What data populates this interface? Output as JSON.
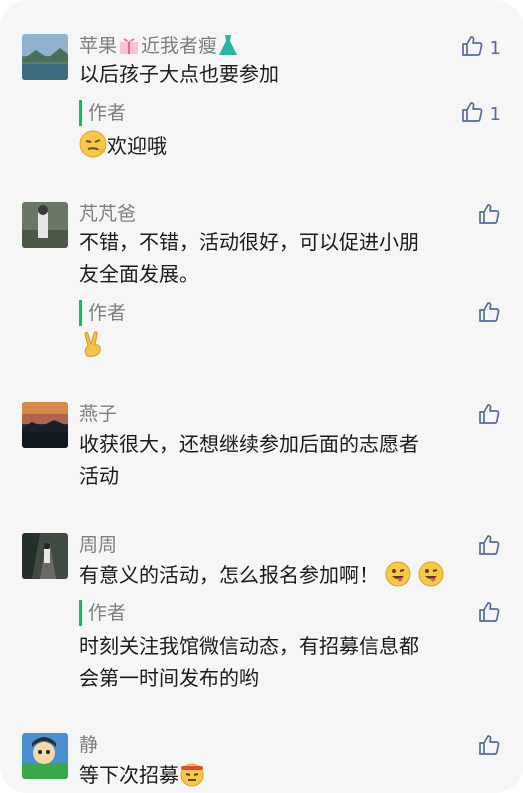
{
  "comments": [
    {
      "name": "苹果",
      "name_suffix": "近我者瘦",
      "text": "以后孩子大点也要参加",
      "likes": "1",
      "reply": {
        "label": "作者",
        "text": "欢迎哦",
        "likes": "1"
      }
    },
    {
      "name": "芃芃爸",
      "text_line1": "不错，不错，活动很好，可以促进小朋",
      "text_line2": "友全面发展。",
      "reply": {
        "label": "作者"
      }
    },
    {
      "name": "燕子",
      "text_line1": "收获很大，还想继续参加后面的志愿者",
      "text_line2": "活动"
    },
    {
      "name": "周周",
      "text": "有意义的活动，怎么报名参加啊！",
      "reply": {
        "label": "作者",
        "text_line1": "时刻关注我馆微信动态，有招募信息都",
        "text_line2": "会第一时间发布的哟"
      }
    },
    {
      "name": "静",
      "text": "等下次招募"
    }
  ],
  "colors": {
    "accent_green": "#07c160",
    "like_blue": "#576b95",
    "meta_gray": "#7f7f7f"
  },
  "icons": [
    "thumbs-up-icon"
  ]
}
